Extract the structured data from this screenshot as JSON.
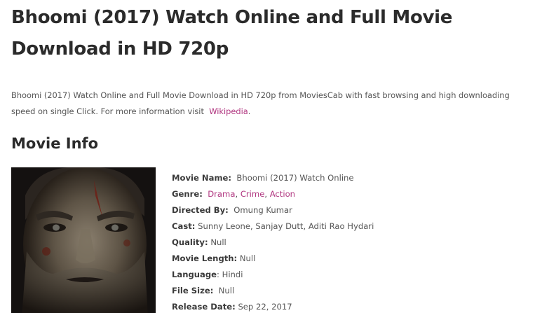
{
  "article": {
    "title": "Bhoomi (2017) Watch Online and Full Movie Download in HD 720p",
    "intro_text": "Bhoomi (2017) Watch Online and Full Movie Download in HD 720p from MoviesCab with fast browsing and high downloading speed on single Click. For more information visit",
    "intro_link": "Wikipedia",
    "intro_end": "."
  },
  "movie_info": {
    "heading": "Movie Info",
    "poster_icon": "movie-poster-image",
    "name_label": "Movie Name:",
    "name_value": "Bhoomi (2017) Watch Online",
    "genre_label": "Genre:",
    "genres": [
      "Drama",
      "Crime",
      "Action"
    ],
    "genre_sep": ",",
    "director_label": "Directed By:",
    "director_value": "Omung Kumar",
    "cast_label": "Cast:",
    "cast_value": "Sunny Leone, Sanjay Dutt, Aditi Rao Hydari",
    "quality_label": "Quality:",
    "quality_value": "Null",
    "length_label": "Movie Length:",
    "length_value": "Null",
    "language_label": "Language",
    "language_colon": ":",
    "language_value": "Hindi",
    "filesize_label": "File Size:",
    "filesize_value": "Null",
    "release_label": "Release Date:",
    "release_value": "Sep 22, 2017"
  },
  "colors": {
    "link": "#b0357f",
    "heading": "#2b2b2b",
    "body_text": "#555555"
  }
}
